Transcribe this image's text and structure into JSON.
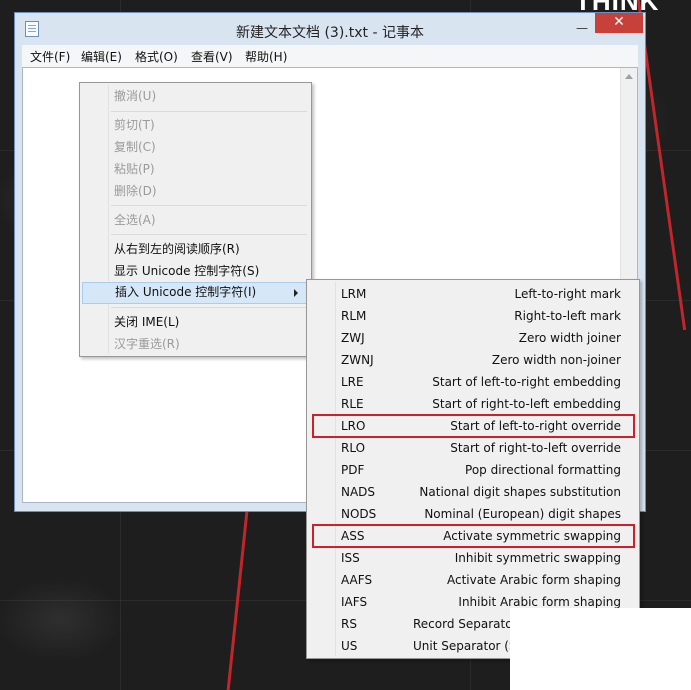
{
  "window": {
    "title": "新建文本文档 (3).txt - 记事本",
    "minimize": "—",
    "maximize": "☐",
    "close": "✕"
  },
  "desktop": {
    "brand_text": "THINK"
  },
  "menubar": [
    {
      "label": "文件(F)"
    },
    {
      "label": "编辑(E)"
    },
    {
      "label": "格式(O)"
    },
    {
      "label": "查看(V)"
    },
    {
      "label": "帮助(H)"
    }
  ],
  "context_menu": {
    "items": [
      {
        "label": "撤消(U)",
        "enabled": false
      },
      {
        "label": "剪切(T)",
        "enabled": false
      },
      {
        "label": "复制(C)",
        "enabled": false
      },
      {
        "label": "粘贴(P)",
        "enabled": false
      },
      {
        "label": "删除(D)",
        "enabled": false
      },
      {
        "label": "全选(A)",
        "enabled": false
      },
      {
        "label": "从右到左的阅读顺序(R)",
        "enabled": true
      },
      {
        "label": "显示 Unicode 控制字符(S)",
        "enabled": true
      },
      {
        "label": "插入 Unicode 控制字符(I)",
        "enabled": true,
        "active": true
      },
      {
        "label": "关闭 IME(L)",
        "enabled": true
      },
      {
        "label": "汉字重选(R)",
        "enabled": false
      }
    ]
  },
  "submenu": {
    "items": [
      {
        "code": "LRM",
        "desc": "Left-to-right mark"
      },
      {
        "code": "RLM",
        "desc": "Right-to-left mark"
      },
      {
        "code": "ZWJ",
        "desc": "Zero width joiner"
      },
      {
        "code": "ZWNJ",
        "desc": "Zero width non-joiner"
      },
      {
        "code": "LRE",
        "desc": "Start of left-to-right embedding"
      },
      {
        "code": "RLE",
        "desc": "Start of right-to-left embedding"
      },
      {
        "code": "LRO",
        "desc": "Start of left-to-right override",
        "highlighted": true
      },
      {
        "code": "RLO",
        "desc": "Start of right-to-left override"
      },
      {
        "code": "PDF",
        "desc": "Pop directional formatting"
      },
      {
        "code": "NADS",
        "desc": "National digit shapes substitution"
      },
      {
        "code": "NODS",
        "desc": "Nominal (European) digit shapes"
      },
      {
        "code": "ASS",
        "desc": "Activate symmetric swapping",
        "highlighted": true
      },
      {
        "code": "ISS",
        "desc": "Inhibit symmetric swapping"
      },
      {
        "code": "AAFS",
        "desc": "Activate Arabic form shaping"
      },
      {
        "code": "IAFS",
        "desc": "Inhibit Arabic form shaping"
      },
      {
        "code": "RS",
        "desc": "Record Separato"
      },
      {
        "code": "US",
        "desc": "Unit Separator (S"
      }
    ]
  }
}
